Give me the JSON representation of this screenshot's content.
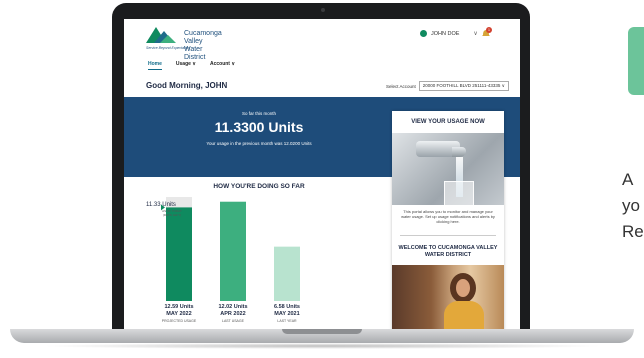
{
  "header": {
    "logo_name_line1": "Cucamonga Valley",
    "logo_name_line2": "Water District",
    "logo_tagline": "Service Beyond Expectation",
    "user_name": "JOHN DOE",
    "notification_count": "1"
  },
  "nav": {
    "home": "Home",
    "usage": "Usage ∨",
    "account": "Account ∨"
  },
  "greeting": "Good Morning, JOHN",
  "account_select": {
    "label": "Select Account",
    "value": "20000 FOOTHILL BLVD 251111-43335 ∨"
  },
  "banner": {
    "small": "So far this month",
    "big": "11.3300 Units",
    "sub": "Your usage in the previous month was 12.0200 Units"
  },
  "card": {
    "title": "VIEW YOUR USAGE NOW",
    "text": "This portal allows you to monitor and manage your water usage. Set up usage notifications and alerts by clicking here.",
    "welcome": "WELCOME TO CUCAMONGA VALLEY WATER DISTRICT"
  },
  "chart_data": {
    "type": "bar",
    "title": "HOW YOU'RE DOING SO FAR",
    "marker_label": "11.33 Units",
    "marker_sub": "AS OF TODAY (DAYS LEFT)",
    "marker_value": 11.33,
    "categories": [
      "MAY 2022",
      "APR 2022",
      "MAY 2021"
    ],
    "values": [
      12.59,
      12.02,
      6.58
    ],
    "value_labels": [
      "12.59 Units",
      "12.02 Units",
      "6.58 Units"
    ],
    "captions": [
      "PROJECTED USAGE",
      "LAST USAGE",
      "LAST YEAR"
    ],
    "colors": [
      "#0f8a5f",
      "#3daf7f",
      "#b8e3cf"
    ],
    "ylim": [
      0,
      12.59
    ]
  },
  "side_text": {
    "line1": "A",
    "line2": "yo",
    "line3": "Re"
  }
}
